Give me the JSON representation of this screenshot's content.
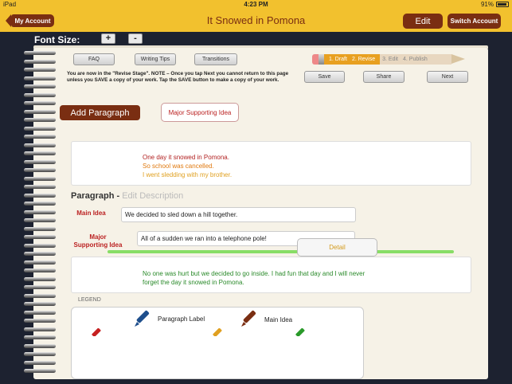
{
  "status": {
    "device": "iPad",
    "time": "4:23 PM",
    "battery": "91%"
  },
  "nav": {
    "back_label": "My Account",
    "title": "It Snowed in Pomona",
    "edit_label": "Edit",
    "switch_label": "Switch Account"
  },
  "font_size": {
    "label": "Font Size:",
    "increase": "+",
    "decrease": "-"
  },
  "toolbar": {
    "faq": "FAQ",
    "writing_tips": "Writing Tips",
    "transitions": "Transitions",
    "save": "Save",
    "share": "Share",
    "next": "Next"
  },
  "notice": "You are now in the \"Revise Stage\". NOTE – Once you tap Next you cannot return to this page unless you SAVE a copy of your work. Tap the SAVE button to make a copy of your work.",
  "stages": {
    "draft": "1. Draft",
    "revise": "2. Revise",
    "edit": "3. Edit",
    "publish": "4. Publish"
  },
  "actions": {
    "add_paragraph": "Add Paragraph",
    "major_supporting_idea": "Major Supporting Idea"
  },
  "preview": {
    "line1": "One day it snowed in Pomona.",
    "line2": "So school was cancelled.",
    "line3": "I went sledding with my brother.",
    "colors": {
      "line1": "#b22222",
      "line2": "#e07a10",
      "line3": "#e0a020"
    }
  },
  "paragraph": {
    "heading": "Paragraph -",
    "edit_description": "Edit Description",
    "main_idea_label": "Main Idea",
    "main_idea_value": "We decided to sled down a hill together.",
    "major_label_line1": "Major",
    "major_label_line2": "Supporting Idea",
    "major_value": "All of a sudden we ran into a telephone pole!",
    "detail_label": "Detail"
  },
  "conclusion": {
    "text": "No one was hurt but we decided to go inside. I had fun that day and I will never forget the day it snowed in Pomona."
  },
  "legend": {
    "title": "LEGEND",
    "paragraph_label": "Paragraph Label",
    "main_idea": "Main Idea"
  },
  "theme": {
    "nav_yellow": "#f2c12e",
    "brand_brown": "#7a2e12",
    "accent_red": "#b22222",
    "accent_green": "#2a8a2a"
  }
}
